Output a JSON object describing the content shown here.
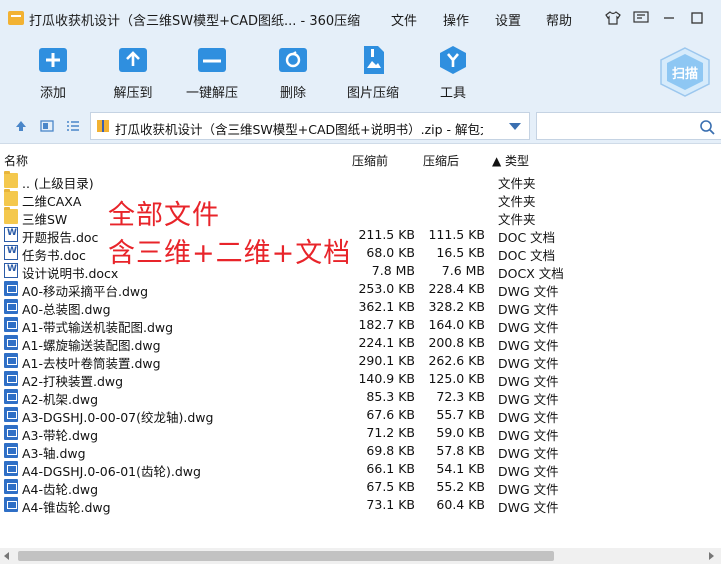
{
  "window": {
    "title": "打瓜收获机设计（含三维SW模型+CAD图纸... - 360压缩",
    "menu": [
      "文件",
      "操作",
      "设置",
      "帮助"
    ]
  },
  "toolbar": {
    "buttons": [
      {
        "label": "添加",
        "icon": "add-icon"
      },
      {
        "label": "解压到",
        "icon": "extract-to-icon"
      },
      {
        "label": "一键解压",
        "icon": "one-click-extract-icon"
      },
      {
        "label": "删除",
        "icon": "delete-icon"
      },
      {
        "label": "图片压缩",
        "icon": "image-compress-icon"
      },
      {
        "label": "工具",
        "icon": "tools-icon"
      }
    ],
    "scan_label": "扫描"
  },
  "address": {
    "path": "打瓜收获机设计（含三维SW模型+CAD图纸+说明书）.zip - 解包大小"
  },
  "columns": {
    "name": "名称",
    "compressed": "压缩前",
    "original": "压缩后",
    "type": "▲ 类型"
  },
  "files": [
    {
      "name": ".. (上级目录)",
      "cs": "",
      "os": "",
      "type": "文件夹",
      "kind": "folder"
    },
    {
      "name": "二维CAXA",
      "cs": "",
      "os": "",
      "type": "文件夹",
      "kind": "folder"
    },
    {
      "name": "三维SW",
      "cs": "",
      "os": "",
      "type": "文件夹",
      "kind": "folder"
    },
    {
      "name": "开题报告.doc",
      "cs": "211.5 KB",
      "os": "111.5 KB",
      "type": "DOC 文档",
      "kind": "doc"
    },
    {
      "name": "任务书.doc",
      "cs": "68.0 KB",
      "os": "16.5 KB",
      "type": "DOC 文档",
      "kind": "doc"
    },
    {
      "name": "设计说明书.docx",
      "cs": "7.8 MB",
      "os": "7.6 MB",
      "type": "DOCX 文档",
      "kind": "doc"
    },
    {
      "name": "A0-移动采摘平台.dwg",
      "cs": "253.0 KB",
      "os": "228.4 KB",
      "type": "DWG 文件",
      "kind": "dwg"
    },
    {
      "name": "A0-总装图.dwg",
      "cs": "362.1 KB",
      "os": "328.2 KB",
      "type": "DWG 文件",
      "kind": "dwg"
    },
    {
      "name": "A1-带式输送机装配图.dwg",
      "cs": "182.7 KB",
      "os": "164.0 KB",
      "type": "DWG 文件",
      "kind": "dwg"
    },
    {
      "name": "A1-螺旋输送装配图.dwg",
      "cs": "224.1 KB",
      "os": "200.8 KB",
      "type": "DWG 文件",
      "kind": "dwg"
    },
    {
      "name": "A1-去枝叶卷筒装置.dwg",
      "cs": "290.1 KB",
      "os": "262.6 KB",
      "type": "DWG 文件",
      "kind": "dwg"
    },
    {
      "name": "A2-打秧装置.dwg",
      "cs": "140.9 KB",
      "os": "125.0 KB",
      "type": "DWG 文件",
      "kind": "dwg"
    },
    {
      "name": "A2-机架.dwg",
      "cs": "85.3 KB",
      "os": "72.3 KB",
      "type": "DWG 文件",
      "kind": "dwg"
    },
    {
      "name": "A3-DGSHJ.0-00-07(绞龙轴).dwg",
      "cs": "67.6 KB",
      "os": "55.7 KB",
      "type": "DWG 文件",
      "kind": "dwg"
    },
    {
      "name": "A3-带轮.dwg",
      "cs": "71.2 KB",
      "os": "59.0 KB",
      "type": "DWG 文件",
      "kind": "dwg"
    },
    {
      "name": "A3-轴.dwg",
      "cs": "69.8 KB",
      "os": "57.8 KB",
      "type": "DWG 文件",
      "kind": "dwg"
    },
    {
      "name": "A4-DGSHJ.0-06-01(齿轮).dwg",
      "cs": "66.1 KB",
      "os": "54.1 KB",
      "type": "DWG 文件",
      "kind": "dwg"
    },
    {
      "name": "A4-齿轮.dwg",
      "cs": "67.5 KB",
      "os": "55.2 KB",
      "type": "DWG 文件",
      "kind": "dwg"
    },
    {
      "name": "A4-锥齿轮.dwg",
      "cs": "73.1 KB",
      "os": "60.4 KB",
      "type": "DWG 文件",
      "kind": "dwg"
    }
  ],
  "overlay": {
    "line1": "全部文件",
    "line2": "含三维+二维+文档"
  },
  "colors": {
    "accent": "#2f8fdf",
    "header_bg": "#e5eff9",
    "overlay_red": "#e8242a"
  }
}
